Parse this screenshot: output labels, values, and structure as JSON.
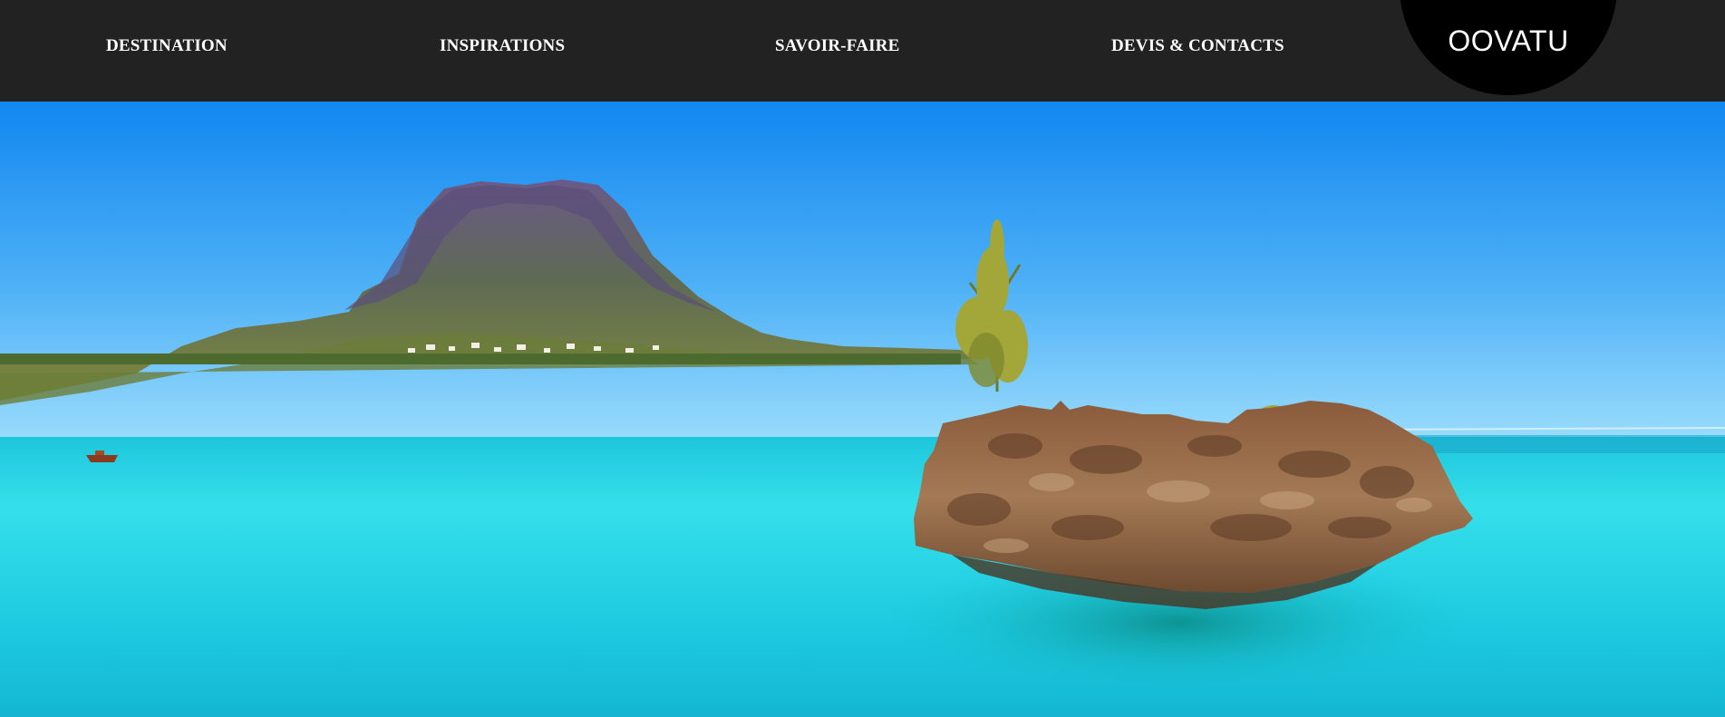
{
  "nav": {
    "items": [
      {
        "label": "DESTINATION"
      },
      {
        "label": "INSPIRATIONS"
      },
      {
        "label": "SAVOIR-FAIRE"
      },
      {
        "label": "DEVIS & CONTACTS"
      }
    ]
  },
  "brand": {
    "logo_text": "OOVATU"
  },
  "hero": {
    "image_icon": "tropical-island-photo"
  },
  "colors": {
    "topbar": "#222222",
    "logo_badge": "#000000",
    "nav_text": "#ffffff",
    "sky_top": "#1187f0",
    "sky_horizon": "#8fd4fb",
    "sea_light": "#2fe3ea",
    "sea_deep": "#0fb2d0"
  }
}
